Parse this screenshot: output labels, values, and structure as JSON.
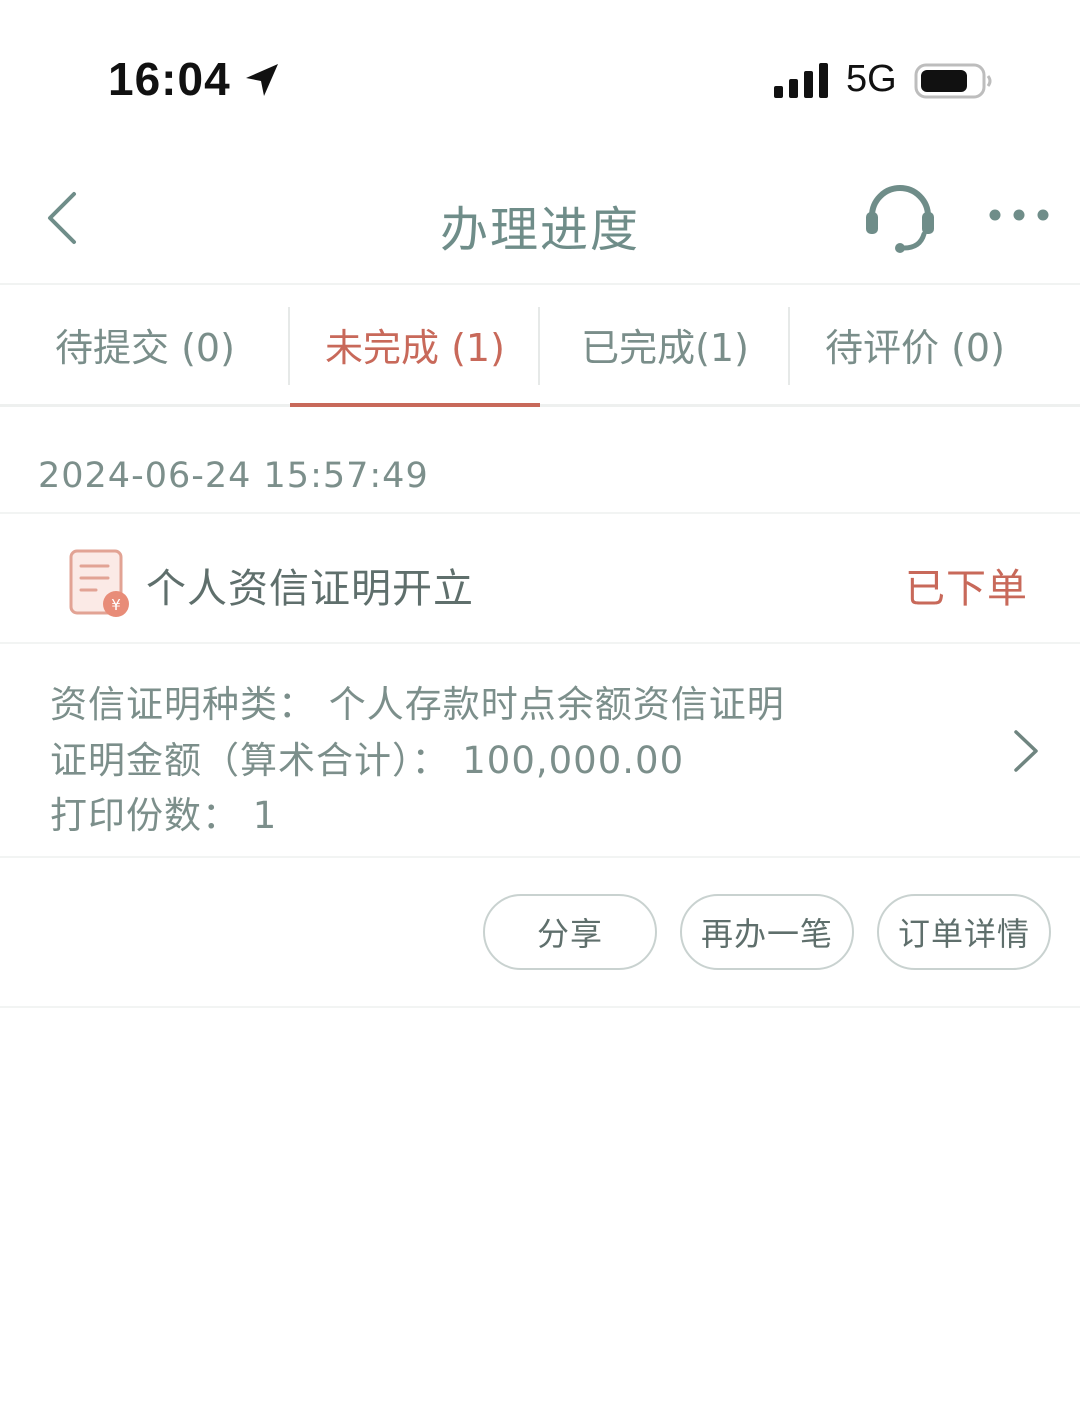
{
  "status_bar": {
    "time": "16:04",
    "network": "5G",
    "icons": [
      "location-arrow-icon",
      "signal-bars-icon",
      "battery-icon"
    ]
  },
  "nav": {
    "title": "办理进度",
    "icons": [
      "chevron-left-icon",
      "headset-icon",
      "more-dots-icon"
    ]
  },
  "tabs": [
    {
      "label": "待提交 (0)",
      "active": false
    },
    {
      "label": "未完成 (1)",
      "active": true
    },
    {
      "label": "已完成(1)",
      "active": false
    },
    {
      "label": "待评价 (0)",
      "active": false
    }
  ],
  "order": {
    "datetime": "2024-06-24 15:57:49",
    "title": "个人资信证明开立",
    "status": "已下单",
    "details": [
      "资信证明种类：  个人存款时点余额资信证明",
      "证明金额（算术合计）：  100,000.00",
      "打印份数：  1"
    ],
    "actions": {
      "share": "分享",
      "redo": "再办一笔",
      "detail": "订单详情"
    }
  },
  "colors": {
    "accent": "#c8695a",
    "text_muted": "#7c8f8b",
    "title": "#6f8d89"
  }
}
